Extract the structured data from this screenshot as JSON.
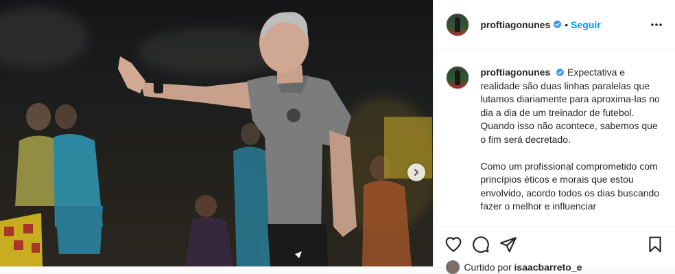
{
  "post": {
    "username": "proftiagonunes",
    "follow_label": "Seguir",
    "separator": "•",
    "caption_paragraphs": [
      "Expectativa e realidade são duas linhas paralelas que lutamos diariamente para aproxima-las no dia a dia de um treinador de futebol. Quando isso não acontece, sabemos que o fim será decretado.",
      "Como um profissional comprometido com princípios éticos e morais que estou envolvido, acordo todos os dias buscando fazer o melhor e influenciar"
    ],
    "liked_by_prefix": "Curtido por",
    "liked_by_user": "isaacbarreto_e"
  },
  "icons": {
    "verified": "verified-badge-icon",
    "more": "more-options-icon",
    "next": "chevron-right-icon",
    "like": "heart-icon",
    "comment": "comment-icon",
    "share": "share-icon",
    "save": "bookmark-icon"
  },
  "colors": {
    "link_blue": "#0095f6",
    "verified_blue": "#3897f0",
    "text": "#262626",
    "border": "#efefef"
  }
}
